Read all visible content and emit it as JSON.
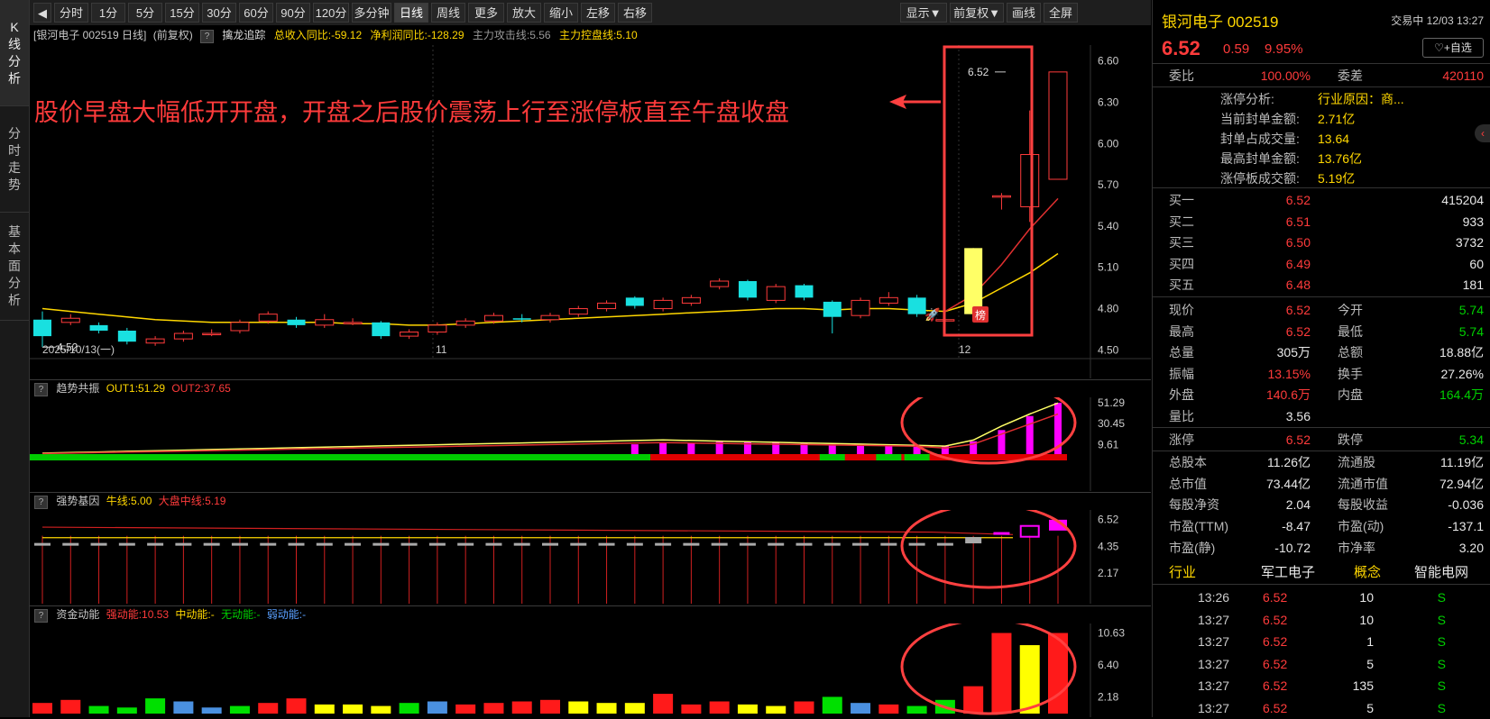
{
  "left_tabs": [
    "K线分析",
    "分时走势",
    "基本面分析"
  ],
  "toolbar": {
    "buttons": [
      "分时",
      "1分",
      "5分",
      "15分",
      "30分",
      "60分",
      "90分",
      "120分",
      "多分钟",
      "日线",
      "周线",
      "更多▼",
      "放大",
      "缩小",
      "左移",
      "右移"
    ],
    "right_buttons": [
      "显示▼",
      "前复权▼",
      "画线",
      "全屏"
    ],
    "active": "日线"
  },
  "info_bar": {
    "title": "[银河电子 002519 日线]",
    "mode": "(前复权)",
    "indicator": "擒龙追踪",
    "revenue": "总收入同比:-59.12",
    "profit": "净利润同比:-128.29",
    "attack": "主力攻击线:5.56",
    "control": "主力控盘线:5.10"
  },
  "annotation": "股价早盘大幅低开开盘，开盘之后股价震荡上行至涨停板直至午盘收盘",
  "main_pane": {
    "y_labels": [
      "6.60",
      "6.30",
      "6.00",
      "5.70",
      "5.40",
      "5.10",
      "4.80",
      "4.50"
    ],
    "x_labels": [
      "2025/10/13(一)",
      "11",
      "12"
    ],
    "low_mark": "4.52",
    "high_mark": "6.52",
    "badge": "榜"
  },
  "pane2": {
    "name": "趋势共振",
    "out1": "OUT1:51.29",
    "out2": "OUT2:37.65",
    "y_labels": [
      "51.29",
      "30.45",
      "9.61"
    ]
  },
  "pane3": {
    "name": "强势基因",
    "bull": "牛线:5.00",
    "market": "大盘中线:5.19",
    "y_labels": [
      "6.52",
      "4.35",
      "2.17"
    ]
  },
  "pane4": {
    "name": "资金动能",
    "strong": "强动能:10.53",
    "mid": "中动能:-",
    "none": "无动能:-",
    "weak": "弱动能:-",
    "y_labels": [
      "10.63",
      "6.40",
      "2.18"
    ]
  },
  "chart_data": {
    "type": "candlestick",
    "ylim": [
      4.45,
      6.65
    ],
    "candles": [
      [
        4.72,
        4.6,
        4.78,
        4.52
      ],
      [
        4.7,
        4.73,
        4.76,
        4.68
      ],
      [
        4.68,
        4.64,
        4.7,
        4.62
      ],
      [
        4.64,
        4.56,
        4.66,
        4.54
      ],
      [
        4.55,
        4.58,
        4.6,
        4.53
      ],
      [
        4.58,
        4.62,
        4.64,
        4.56
      ],
      [
        4.62,
        4.62,
        4.65,
        4.6
      ],
      [
        4.64,
        4.7,
        4.72,
        4.62
      ],
      [
        4.71,
        4.76,
        4.78,
        4.69
      ],
      [
        4.72,
        4.68,
        4.74,
        4.66
      ],
      [
        4.68,
        4.72,
        4.76,
        4.66
      ],
      [
        4.7,
        4.7,
        4.73,
        4.68
      ],
      [
        4.7,
        4.6,
        4.71,
        4.58
      ],
      [
        4.6,
        4.63,
        4.65,
        4.58
      ],
      [
        4.63,
        4.68,
        4.7,
        4.61
      ],
      [
        4.68,
        4.71,
        4.73,
        4.66
      ],
      [
        4.71,
        4.75,
        4.77,
        4.69
      ],
      [
        4.73,
        4.72,
        4.76,
        4.7
      ],
      [
        4.72,
        4.75,
        4.77,
        4.7
      ],
      [
        4.76,
        4.8,
        4.82,
        4.74
      ],
      [
        4.8,
        4.84,
        4.86,
        4.78
      ],
      [
        4.88,
        4.82,
        4.89,
        4.8
      ],
      [
        4.8,
        4.86,
        4.88,
        4.78
      ],
      [
        4.84,
        4.88,
        4.9,
        4.82
      ],
      [
        4.96,
        5.0,
        5.02,
        4.94
      ],
      [
        5.0,
        4.88,
        5.01,
        4.86
      ],
      [
        4.86,
        4.96,
        4.98,
        4.84
      ],
      [
        4.97,
        4.88,
        4.98,
        4.86
      ],
      [
        4.85,
        4.74,
        4.86,
        4.62
      ],
      [
        4.75,
        4.86,
        4.88,
        4.73
      ],
      [
        4.84,
        4.88,
        4.92,
        4.82
      ],
      [
        4.88,
        4.76,
        4.9,
        4.74
      ],
      [
        4.71,
        4.72,
        4.74,
        4.69
      ],
      [
        4.76,
        5.24,
        5.24,
        4.74
      ],
      [
        5.62,
        5.62,
        5.64,
        5.52
      ],
      [
        5.54,
        5.92,
        6.24,
        5.43
      ],
      [
        5.74,
        6.52,
        6.52,
        5.74
      ]
    ],
    "ma_yellow": [
      4.8,
      4.78,
      4.76,
      4.74,
      4.72,
      4.71,
      4.7,
      4.7,
      4.7,
      4.7,
      4.7,
      4.69,
      4.69,
      4.68,
      4.68,
      4.69,
      4.7,
      4.71,
      4.72,
      4.73,
      4.74,
      4.75,
      4.76,
      4.77,
      4.78,
      4.79,
      4.8,
      4.8,
      4.79,
      4.8,
      4.8,
      4.79,
      4.78,
      4.84,
      4.95,
      5.06,
      5.2
    ],
    "ma_red": [
      null,
      null,
      null,
      null,
      null,
      null,
      null,
      null,
      null,
      null,
      null,
      null,
      null,
      null,
      null,
      null,
      null,
      null,
      null,
      null,
      null,
      null,
      null,
      null,
      null,
      null,
      null,
      null,
      null,
      null,
      null,
      null,
      4.78,
      4.9,
      5.12,
      5.38,
      5.6
    ]
  },
  "pane2_data": {
    "green_end": 22,
    "bars_magenta": [
      null,
      null,
      null,
      null,
      null,
      null,
      null,
      null,
      null,
      null,
      null,
      null,
      null,
      null,
      null,
      null,
      null,
      null,
      null,
      null,
      null,
      9.8,
      11.0,
      11.2,
      12.3,
      12.0,
      12.0,
      11.2,
      9.8,
      9.7,
      9.5,
      9.2,
      8.5,
      12.8,
      24.0,
      38.0,
      51.3
    ],
    "bars_green_tail": [
      28,
      30,
      31
    ]
  },
  "pane4_data": {
    "bars": [
      [
        "red",
        1.4
      ],
      [
        "red",
        1.8
      ],
      [
        "green",
        1.0
      ],
      [
        "green",
        0.8
      ],
      [
        "green",
        2.0
      ],
      [
        "blue",
        1.6
      ],
      [
        "blue",
        0.8
      ],
      [
        "green",
        1.0
      ],
      [
        "red",
        1.4
      ],
      [
        "red",
        2.0
      ],
      [
        "yellow",
        1.2
      ],
      [
        "yellow",
        1.2
      ],
      [
        "yellow",
        1.0
      ],
      [
        "green",
        1.4
      ],
      [
        "blue",
        1.6
      ],
      [
        "red",
        1.2
      ],
      [
        "red",
        1.4
      ],
      [
        "red",
        1.6
      ],
      [
        "red",
        1.8
      ],
      [
        "yellow",
        1.6
      ],
      [
        "yellow",
        1.4
      ],
      [
        "yellow",
        1.4
      ],
      [
        "red",
        2.6
      ],
      [
        "red",
        1.2
      ],
      [
        "red",
        1.6
      ],
      [
        "yellow",
        1.2
      ],
      [
        "yellow",
        1.0
      ],
      [
        "red",
        1.6
      ],
      [
        "green",
        2.2
      ],
      [
        "blue",
        1.4
      ],
      [
        "red",
        1.2
      ],
      [
        "green",
        1.0
      ],
      [
        "green",
        1.8
      ],
      [
        "red",
        3.6
      ],
      [
        "red",
        10.6
      ],
      [
        "yellow",
        9.0
      ],
      [
        "red",
        10.6
      ]
    ]
  },
  "right_panel": {
    "name": "银河电子 002519",
    "status": "交易中 12/03 13:27",
    "price": "6.52",
    "change": "0.59",
    "pct": "9.95%",
    "fav": "+自选",
    "wei_bi_label": "委比",
    "wei_bi": "100.00%",
    "wei_cha_label": "委差",
    "wei_cha": "420110",
    "limit": [
      [
        "涨停分析:",
        "行业原因：商..."
      ],
      [
        "当前封单金额:",
        "2.71亿"
      ],
      [
        "封单占成交量:",
        "13.64"
      ],
      [
        "最高封单金额:",
        "13.76亿"
      ],
      [
        "涨停板成交额:",
        "5.19亿"
      ]
    ],
    "bids": [
      [
        "买一",
        "6.52",
        "415204"
      ],
      [
        "买二",
        "6.51",
        "933"
      ],
      [
        "买三",
        "6.50",
        "3732"
      ],
      [
        "买四",
        "6.49",
        "60"
      ],
      [
        "买五",
        "6.48",
        "181"
      ]
    ],
    "stats": [
      [
        "现价",
        "6.52",
        "今开",
        "5.74"
      ],
      [
        "最高",
        "6.52",
        "最低",
        "5.74"
      ],
      [
        "总量",
        "305万",
        "总额",
        "18.88亿"
      ],
      [
        "振幅",
        "13.15%",
        "换手",
        "27.26%"
      ],
      [
        "外盘",
        "140.6万",
        "内盘",
        "164.4万"
      ],
      [
        "量比",
        "3.56",
        "",
        ""
      ],
      [
        "涨停",
        "6.52",
        "跌停",
        "5.34"
      ],
      [
        "总股本",
        "11.26亿",
        "流通股",
        "11.19亿"
      ],
      [
        "总市值",
        "73.44亿",
        "流通市值",
        "72.94亿"
      ],
      [
        "每股净资",
        "2.04",
        "每股收益",
        "-0.036"
      ],
      [
        "市盈(TTM)",
        "-8.47",
        "市盈(动)",
        "-137.1"
      ],
      [
        "市盈(静)",
        "-10.72",
        "市净率",
        "3.20"
      ]
    ],
    "industry": [
      "行业",
      "军工电子",
      "概念",
      "智能电网"
    ],
    "ticks": [
      [
        "13:26",
        "6.52",
        "10",
        "S"
      ],
      [
        "13:27",
        "6.52",
        "10",
        "S"
      ],
      [
        "13:27",
        "6.52",
        "1",
        "S"
      ],
      [
        "13:27",
        "6.52",
        "5",
        "S"
      ],
      [
        "13:27",
        "6.52",
        "135",
        "S"
      ],
      [
        "13:27",
        "6.52",
        "5",
        "S"
      ]
    ]
  }
}
